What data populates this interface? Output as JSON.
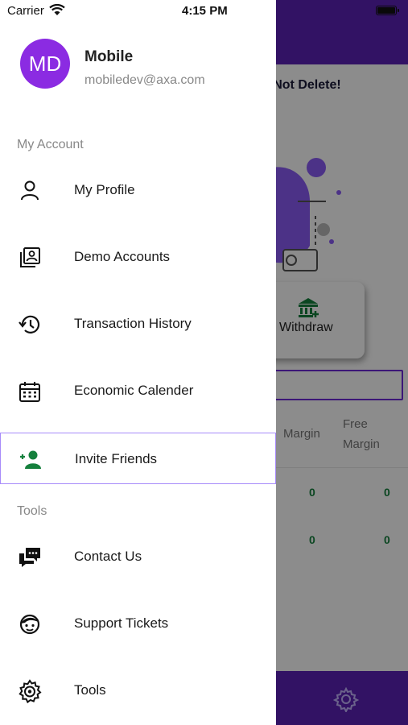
{
  "status_bar": {
    "carrier": "Carrier",
    "time": "4:15 PM"
  },
  "background": {
    "title": "o Not Delete!",
    "withdraw_label": "Withdraw",
    "columns": {
      "margin": "Margin",
      "free_margin": "Free Margin"
    },
    "rows": [
      {
        "margin": "0",
        "free_margin": "0"
      },
      {
        "margin": "0",
        "free_margin": "0"
      }
    ],
    "accent_color": "#5b21b6",
    "value_color": "#15803d"
  },
  "user": {
    "initials": "MD",
    "name": "Mobile",
    "email": "mobiledev@axa.com",
    "avatar_color": "#8b2be2"
  },
  "sections": {
    "account": "My Account",
    "tools": "Tools"
  },
  "menu": {
    "account_items": [
      {
        "label": "My Profile",
        "icon": "person-icon"
      },
      {
        "label": "Demo Accounts",
        "icon": "accounts-icon"
      },
      {
        "label": "Transaction History",
        "icon": "history-icon"
      },
      {
        "label": "Economic Calender",
        "icon": "calendar-icon"
      },
      {
        "label": "Invite Friends",
        "icon": "add-person-icon",
        "active": true,
        "icon_color": "#15803d"
      }
    ],
    "tools_items": [
      {
        "label": "Contact Us",
        "icon": "chat-icon"
      },
      {
        "label": "Support Tickets",
        "icon": "support-icon"
      },
      {
        "label": "Tools",
        "icon": "gear-icon"
      }
    ]
  }
}
